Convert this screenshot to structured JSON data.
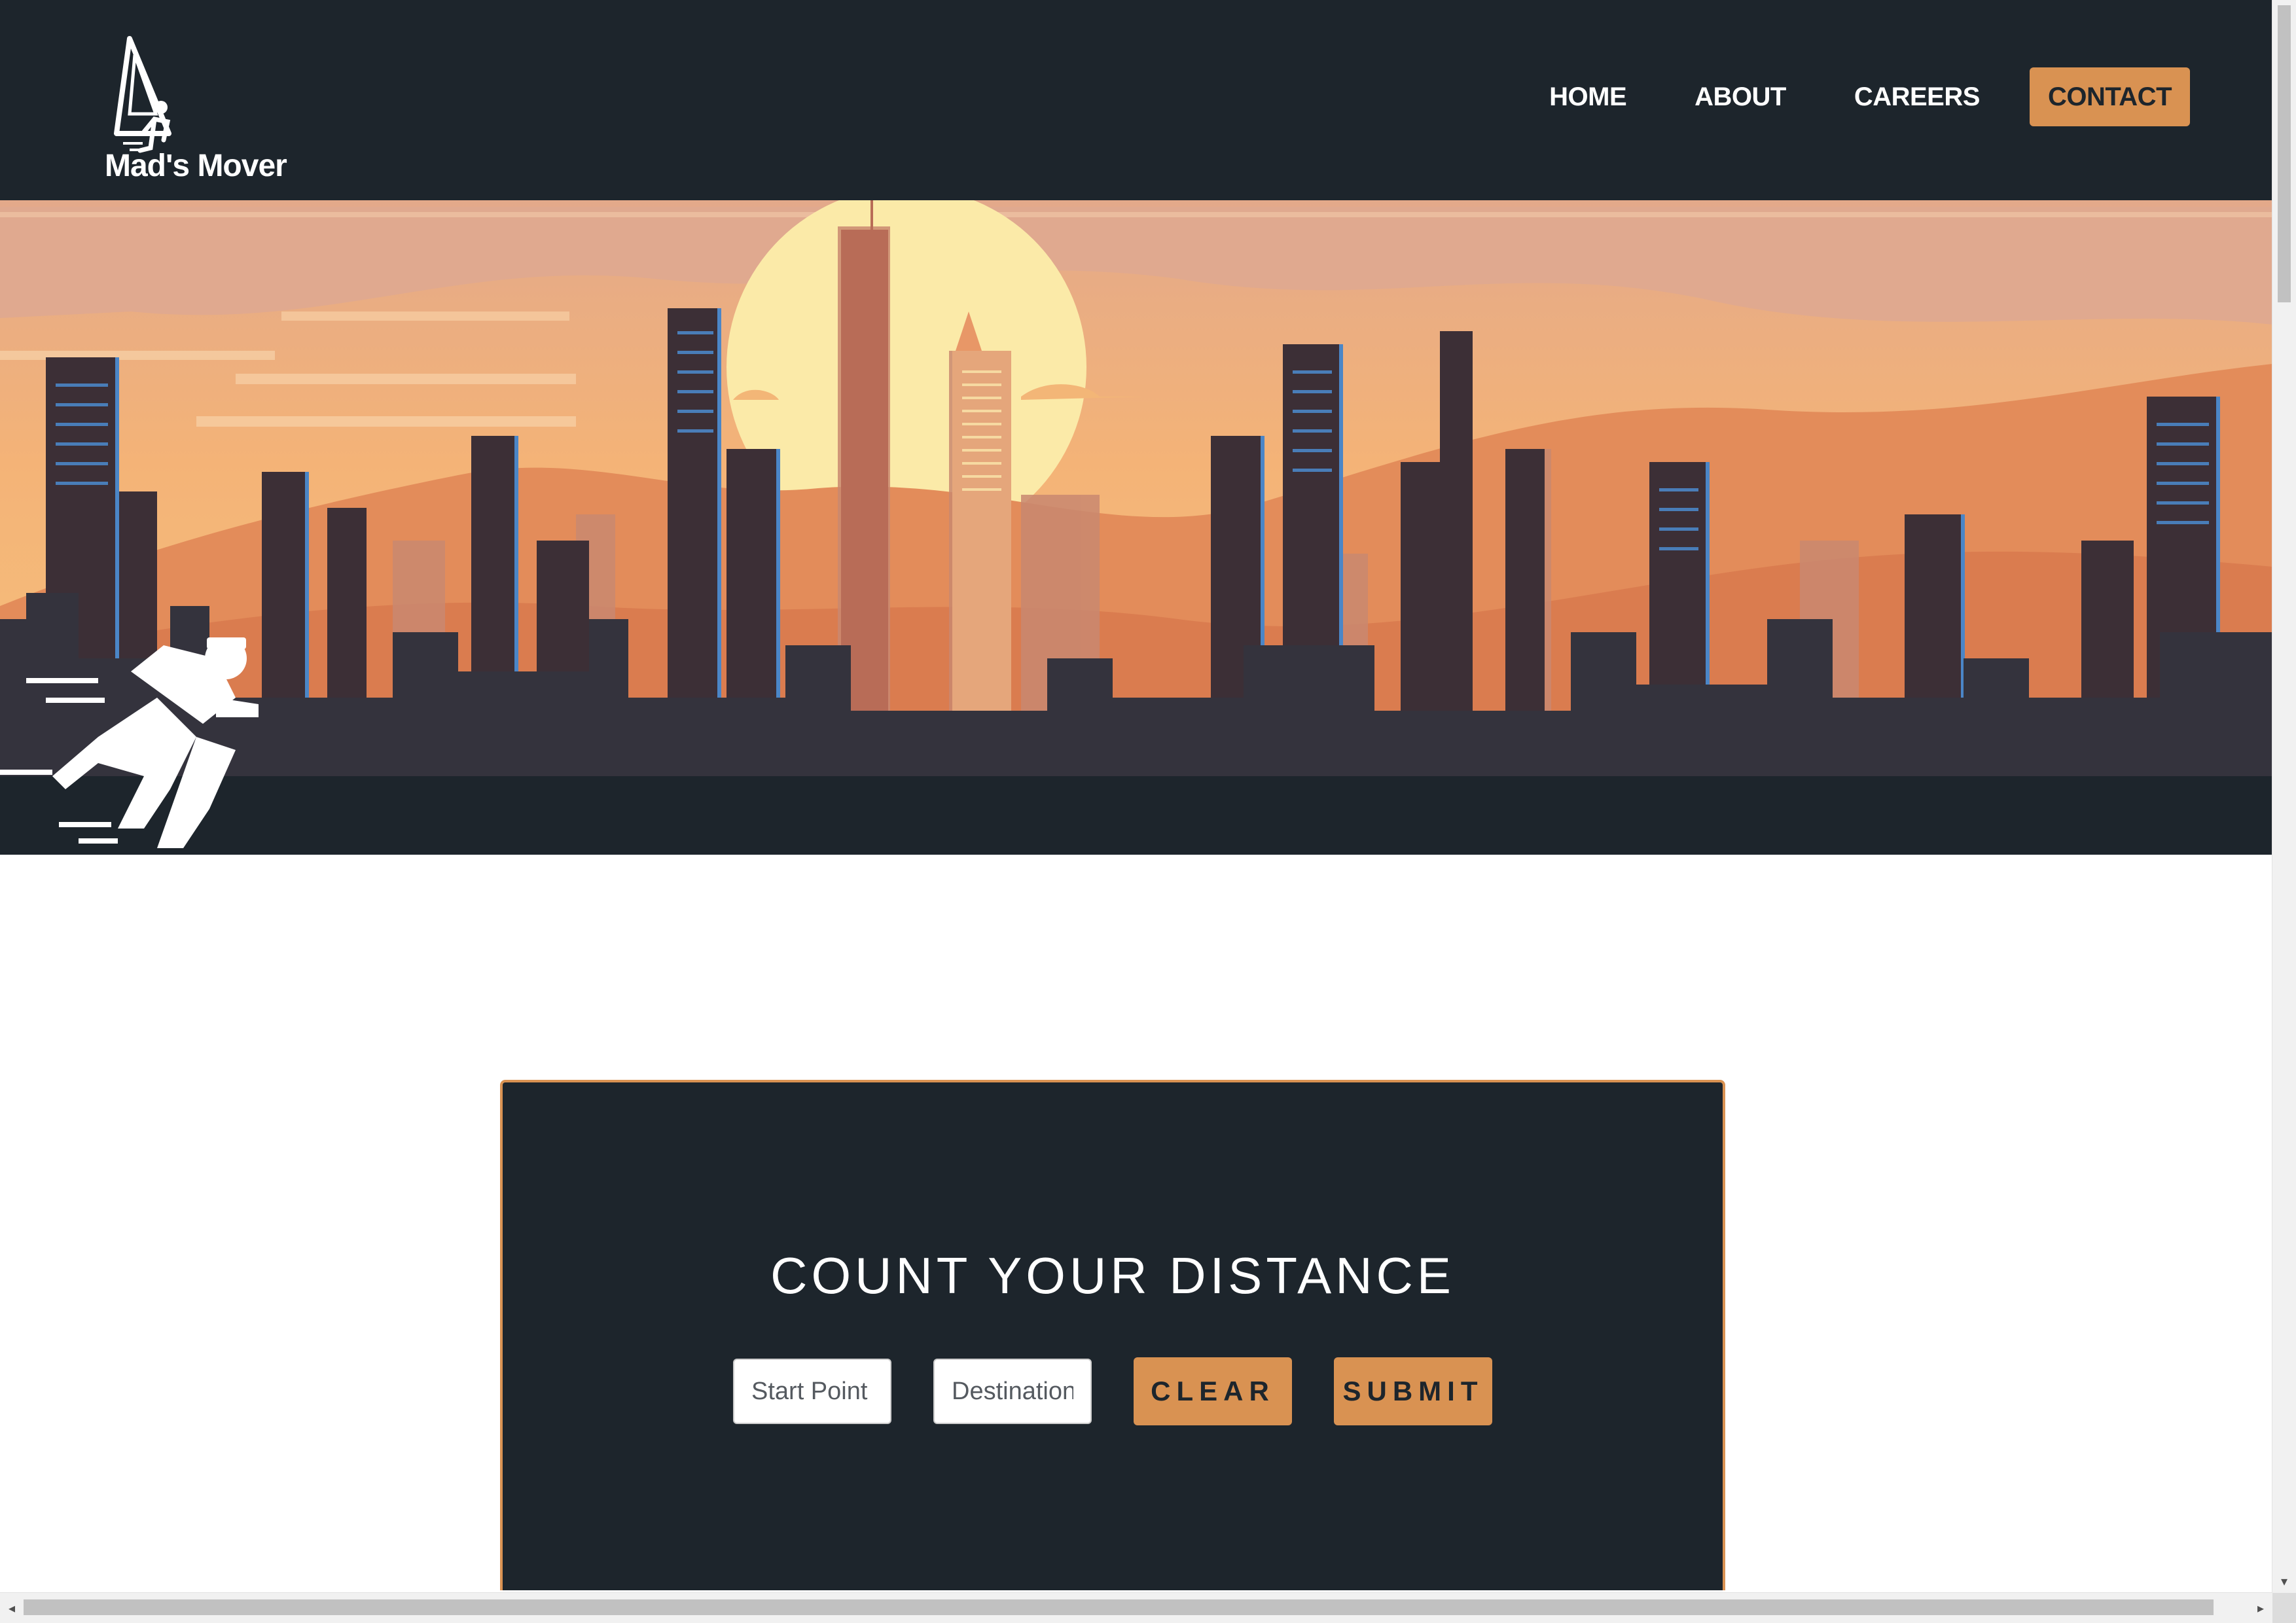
{
  "brand": {
    "name": "Mad's Mover",
    "logo_icon": "running-mover-logo-icon"
  },
  "nav": {
    "items": [
      {
        "label": "HOME"
      },
      {
        "label": "ABOUT"
      },
      {
        "label": "CAREERS"
      },
      {
        "label": "CONTACT"
      }
    ]
  },
  "hero": {
    "image": "sunset-city-skyline-illustration",
    "mascot": "running-delivery-man-icon"
  },
  "distance_form": {
    "title": "COUNT YOUR DISTANCE",
    "start_placeholder": "Start Point",
    "destination_placeholder": "Destination",
    "clear_label": "CLEAR",
    "submit_label": "SUBMIT"
  },
  "colors": {
    "header_bg": "#1d252c",
    "accent": "#d99252",
    "sky": "#f3b677",
    "sun": "#fbeaa8"
  }
}
